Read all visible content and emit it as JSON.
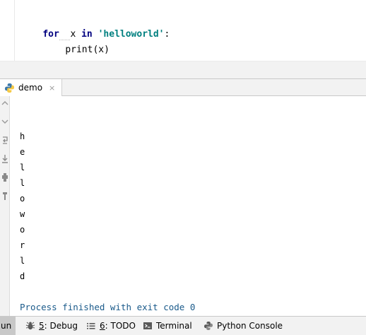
{
  "editor": {
    "line1": {
      "kw_for": "for",
      "var": "x",
      "kw_in": "in",
      "string": "'helloworld'",
      "colon": ":"
    },
    "line2": {
      "call": "print(x)"
    }
  },
  "run_panel": {
    "tab_label": "demo",
    "close_glyph": "×",
    "output_lines": [
      "h",
      "e",
      "l",
      "l",
      "o",
      "w",
      "o",
      "r",
      "l",
      "d"
    ],
    "exit_message": "Process finished with exit code 0"
  },
  "status_bar": {
    "run_label_partial": "un",
    "debug_mnemonic": "5",
    "debug_label": ": Debug",
    "todo_mnemonic": "6",
    "todo_label": ": TODO",
    "terminal_label": "Terminal",
    "python_console_label": "Python Console"
  },
  "icons": {
    "tab": "python-icon",
    "debug": "bug-icon",
    "todo": "list-icon",
    "terminal": "terminal-icon",
    "python_console": "python-console-icon"
  },
  "colors": {
    "keyword": "#000080",
    "string": "#008080",
    "exit_message": "#1a5a8a"
  }
}
